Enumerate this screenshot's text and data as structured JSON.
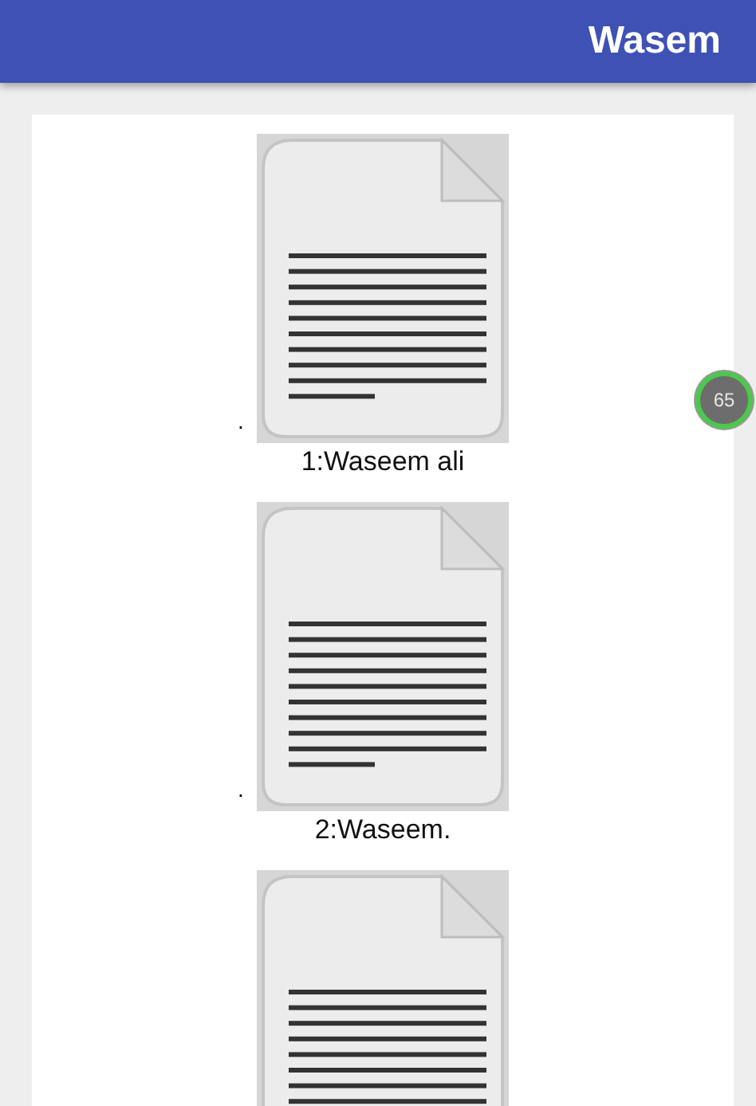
{
  "app_bar": {
    "title": "Wasem"
  },
  "files": [
    {
      "kind": "document",
      "marker": ".",
      "caption": "1:Waseem ali"
    },
    {
      "kind": "document",
      "marker": ".",
      "caption": "2:Waseem."
    },
    {
      "kind": "document"
    }
  ],
  "floating_badge": {
    "text": "65"
  }
}
